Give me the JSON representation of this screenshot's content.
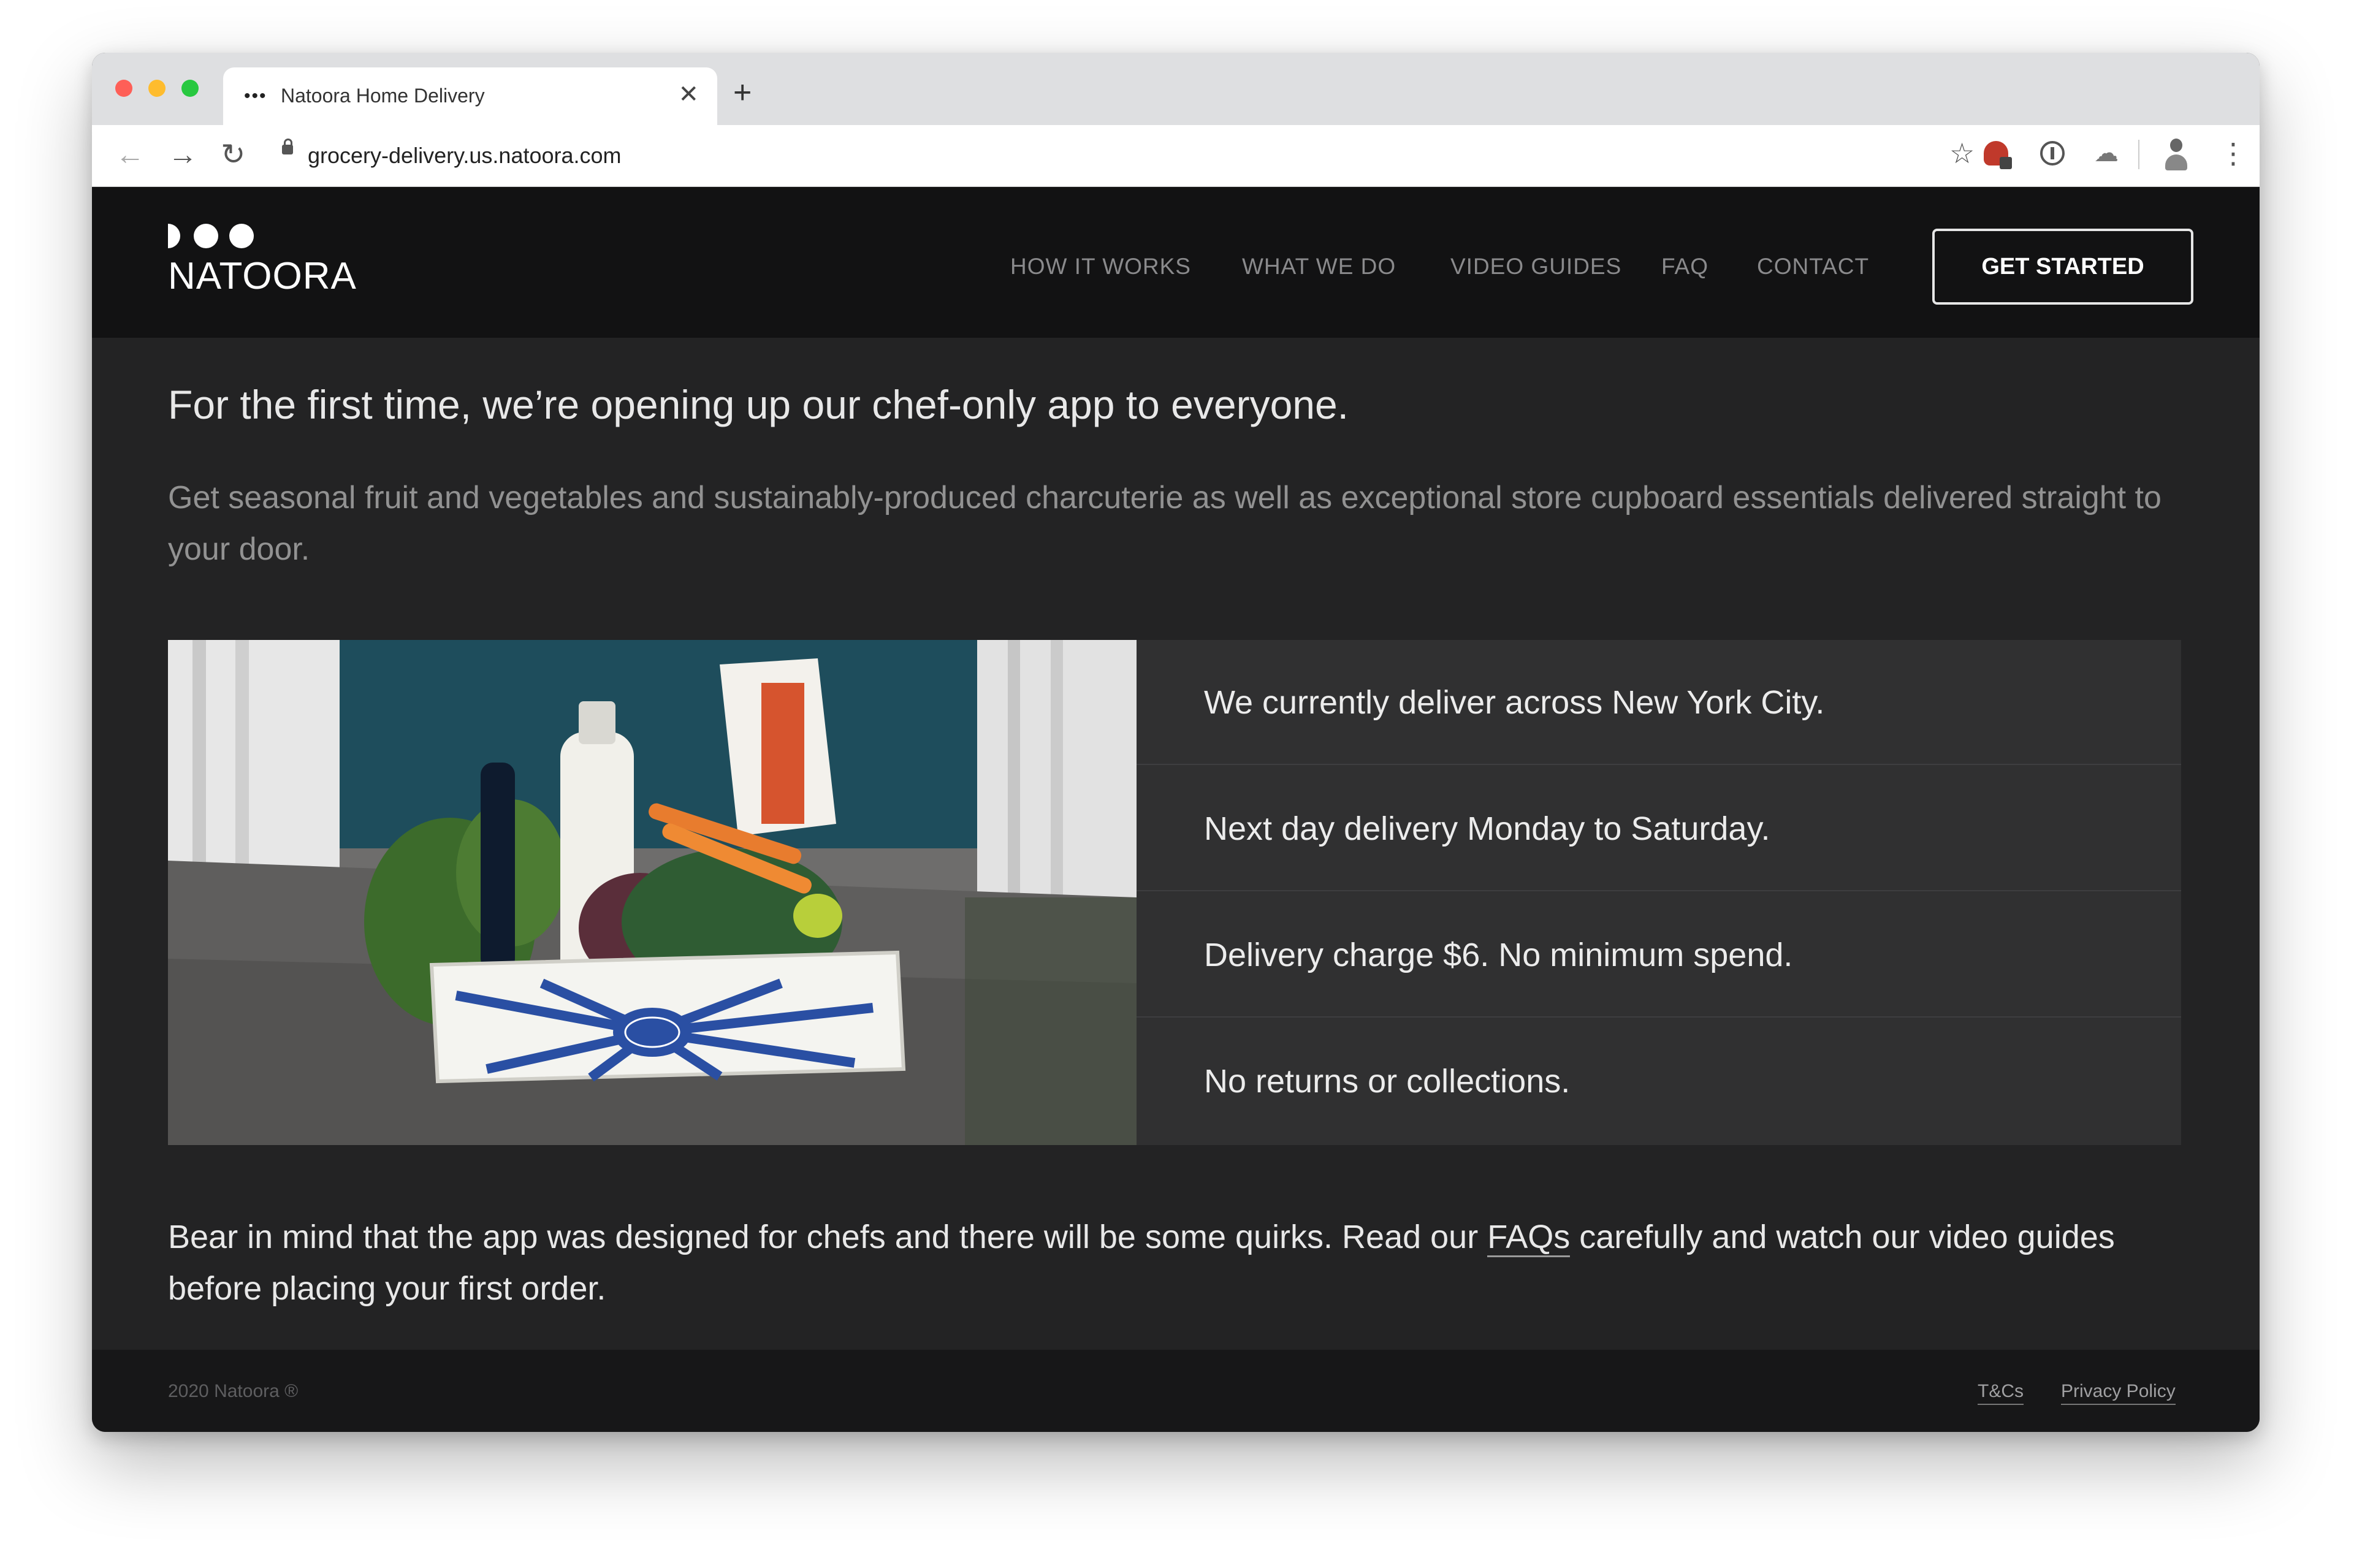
{
  "browser": {
    "tab_title": "Natoora Home Delivery",
    "tab_favicon": "•••",
    "close_glyph": "✕",
    "new_tab_glyph": "+",
    "back_glyph": "←",
    "forward_glyph": "→",
    "reload_glyph": "↻",
    "url": "grocery-delivery.us.natoora.com",
    "star_glyph": "☆",
    "menu_glyph": "⋮",
    "icons": [
      "lock-icon",
      "star-icon",
      "extension-icon",
      "info-icon",
      "cloud-icon",
      "profile-icon",
      "menu-icon"
    ]
  },
  "header": {
    "logo_text": "NATOORA",
    "nav": [
      "HOW IT WORKS",
      "WHAT WE DO",
      "VIDEO GUIDES",
      "FAQ",
      "CONTACT"
    ],
    "cta_label": "GET STARTED"
  },
  "content": {
    "headline": "For the first time, we’re opening up our chef-only app to everyone.",
    "intro": "Get seasonal fruit and vegetables and sustainably-produced charcuterie as well as exceptional store cupboard essentials delivered straight to your door.",
    "info": [
      "We currently deliver across New York City.",
      "Next day delivery Monday to Saturday.",
      "Delivery charge $6. No minimum spend.",
      "No returns or collections."
    ],
    "bear_before": "Bear in mind that the app was designed for chefs and there will be some quirks. Read our ",
    "bear_link": "FAQs",
    "bear_after": " carefully and watch our video guides before placing your first order."
  },
  "footer": {
    "copyright": "2020 Natoora ®",
    "links": [
      "T&Cs",
      "Privacy Policy"
    ]
  },
  "colors": {
    "header_bg": "#121213",
    "page_bg": "#232324",
    "panel_bg": "#303031",
    "footer_bg": "#171718",
    "crate_blue": "#2a4fa3"
  }
}
